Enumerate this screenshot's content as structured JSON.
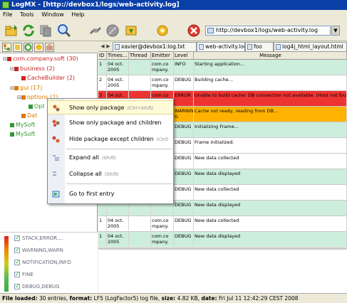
{
  "window": {
    "title": "LogMX - [http://devbox1/logs/web-activity.log]"
  },
  "menu": [
    "File",
    "Tools",
    "Window",
    "Help"
  ],
  "toolbar": {
    "url": "http://devbox1/logs/web-activity.log"
  },
  "tree": [
    {
      "label": "com.company.soft (30)",
      "color": "#cc2222",
      "level": 0,
      "expander": "⊟"
    },
    {
      "label": "business (2)",
      "color": "#cc2222",
      "level": 1,
      "expander": "⊟"
    },
    {
      "label": "CacheBuilder (2)",
      "color": "#cc2222",
      "level": 2,
      "expander": ""
    },
    {
      "label": "gui (17)",
      "color": "#dd7700",
      "level": 1,
      "expander": "⊟"
    },
    {
      "label": "options (2)",
      "color": "#dd7700",
      "level": 2,
      "expander": "⊟"
    },
    {
      "label": "Opt",
      "color": "#339933",
      "level": 3,
      "expander": ""
    },
    {
      "label": "Dat",
      "color": "#dd7700",
      "level": 2,
      "expander": ""
    },
    {
      "label": "MySoft",
      "color": "#339933",
      "level": 1,
      "expander": ""
    },
    {
      "label": "MySoft",
      "color": "#339933",
      "level": 1,
      "expander": ""
    }
  ],
  "legend": [
    {
      "label": "STACK,ERROR,..."
    },
    {
      "label": "WARNING,WARN"
    },
    {
      "label": "NOTIFICATION,INFO"
    },
    {
      "label": "FINE"
    },
    {
      "label": "DEBUG,DEBUG"
    }
  ],
  "tabs": [
    {
      "label": "xavier@devbox1:log.txt",
      "active": false
    },
    {
      "label": "web-activity.log",
      "active": true
    },
    {
      "label": "foo",
      "active": false
    },
    {
      "label": "log4j_html_layout.html",
      "active": false
    }
  ],
  "columns": [
    "ID",
    "Times...",
    "Thread",
    "Emitter",
    "Level",
    "Message"
  ],
  "rows": [
    {
      "id": "1",
      "time": "04 oct. 2005",
      "thread": "",
      "emitter": "com.co mpany.",
      "level": "INFO",
      "message": "Starting application...",
      "bg": "#cdeedd"
    },
    {
      "id": "2",
      "time": "04 oct. 2005",
      "thread": "",
      "emitter": "com.co mpany.",
      "level": "DEBUG",
      "message": "Building cache...",
      "bg": "#ffffff"
    },
    {
      "id": "3",
      "time": "04 oct. 2005",
      "thread": "",
      "emitter": "com.co mpany.",
      "level": "ERROR",
      "message": "Unable to build cache: DB connection not available. (Host not found",
      "bg": "#ee3333"
    },
    {
      "id": "",
      "time": "",
      "thread": "",
      "emitter": "",
      "level": "WARNIN G",
      "message": "Cache not ready, reading from DB...",
      "bg": "#ffb300"
    },
    {
      "id": "",
      "time": "",
      "thread": "",
      "emitter": "",
      "level": "DEBUG",
      "message": "Initializing Frame...",
      "bg": "#cdeedd"
    },
    {
      "id": "",
      "time": "",
      "thread": "",
      "emitter": "",
      "level": "DEBUG",
      "message": "Frame initialized.",
      "bg": "#ffffff"
    },
    {
      "id": "",
      "time": "",
      "thread": "",
      "emitter": "",
      "level": "DEBUG",
      "message": "New data collected",
      "bg": "#ffffff"
    },
    {
      "id": "",
      "time": "",
      "thread": "",
      "emitter": "",
      "level": "DEBUG",
      "message": "New data displayed",
      "bg": "#cdeedd"
    },
    {
      "id": "",
      "time": "",
      "thread": "",
      "emitter": "",
      "level": "DEBUG",
      "message": "New data collected",
      "bg": "#ffffff"
    },
    {
      "id": "",
      "time": "",
      "thread": "",
      "emitter": "",
      "level": "DEBUG",
      "message": "New data displayed",
      "bg": "#cdeedd"
    },
    {
      "id": "1",
      "time": "04 oct. 2005",
      "thread": "",
      "emitter": "com.co mpany.",
      "level": "DEBUG",
      "message": "New data collected",
      "bg": "#ffffff"
    },
    {
      "id": "1",
      "time": "04 oct. 2005",
      "thread": "",
      "emitter": "com.co mpany.",
      "level": "DEBUG",
      "message": "New data displayed",
      "bg": "#cdeedd"
    }
  ],
  "context_menu": [
    {
      "label": "Show only package",
      "shortcut": "(Ctrl+Shift)",
      "icon": "package-filter-icon",
      "highlight": true
    },
    {
      "label": "Show only package and children",
      "shortcut": "",
      "icon": "package-children-icon",
      "highlight": false
    },
    {
      "label": "Hide package except children",
      "shortcut": "(Ctrl)",
      "icon": "hide-package-icon",
      "highlight": false
    },
    {
      "label": "Expand all",
      "shortcut": "(Shift)",
      "icon": "expand-all-icon",
      "highlight": false
    },
    {
      "label": "Collapse all",
      "shortcut": "(Shift)",
      "icon": "collapse-all-icon",
      "highlight": false
    },
    {
      "label": "Go to first entry",
      "shortcut": "",
      "icon": "go-first-entry-icon",
      "highlight": false
    }
  ],
  "status": {
    "file_loaded_label": "File loaded:",
    "file_loaded": "30 entries,",
    "format_label": "format:",
    "format": "LF5 (LogFactor5) log file,",
    "size_label": "size:",
    "size": "4.82 KB,",
    "date_label": "date:",
    "date": "Fri Jul 11 12:42:29 CEST 2008"
  }
}
